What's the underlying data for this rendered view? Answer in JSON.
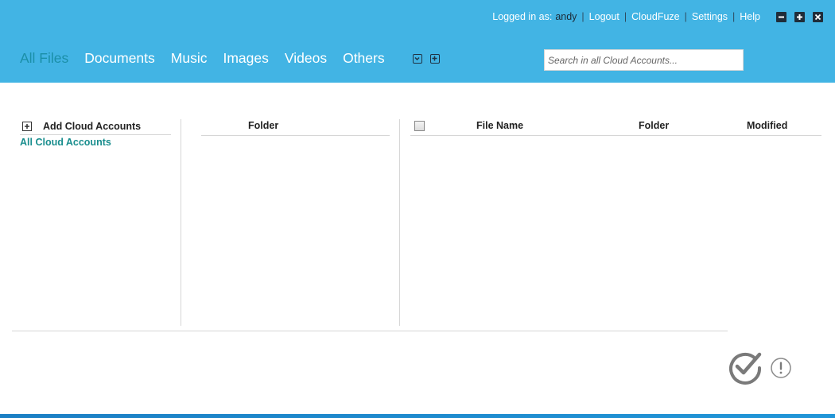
{
  "header": {
    "logged_in_label": "Logged in as:",
    "username": "andy",
    "links": [
      "Logout",
      "CloudFuze",
      "Settings",
      "Help"
    ],
    "window_buttons": [
      "minimize-icon",
      "maximize-icon",
      "close-icon"
    ]
  },
  "nav": {
    "tabs": [
      {
        "label": "All Files",
        "active": true
      },
      {
        "label": "Documents",
        "active": false
      },
      {
        "label": "Music",
        "active": false
      },
      {
        "label": "Images",
        "active": false
      },
      {
        "label": "Videos",
        "active": false
      },
      {
        "label": "Others",
        "active": false
      }
    ],
    "icons": [
      "dropdown-icon",
      "add-tab-icon"
    ]
  },
  "search": {
    "placeholder": "Search in all Cloud Accounts...",
    "value": ""
  },
  "left_panel": {
    "add_label": "Add Cloud Accounts",
    "all_accounts_label": "All Cloud Accounts"
  },
  "folder_panel": {
    "header": "Folder"
  },
  "file_table": {
    "columns": [
      "File Name",
      "Folder",
      "Modified"
    ],
    "rows": []
  },
  "status": {
    "icons": [
      "check-circle-icon",
      "alert-circle-icon"
    ]
  },
  "colors": {
    "header_bg": "#42b4e4",
    "active_tab": "#1b8fa8",
    "link_teal": "#1a8e8e",
    "footer": "#1b7fc4"
  }
}
